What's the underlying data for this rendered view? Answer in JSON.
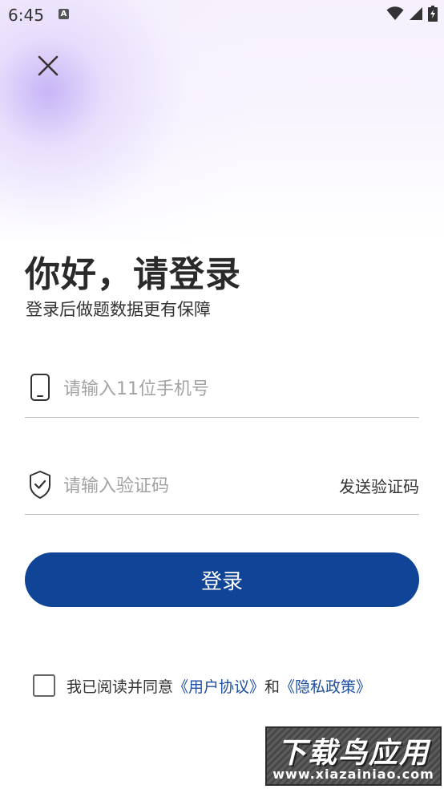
{
  "status_bar": {
    "time": "6:45",
    "notification_icon": "A"
  },
  "header": {
    "close_icon": "close-icon"
  },
  "main": {
    "title": "你好，请登录",
    "subtitle": "登录后做题数据更有保障"
  },
  "form": {
    "phone": {
      "placeholder": "请输入11位手机号",
      "value": "",
      "icon": "phone-icon"
    },
    "code": {
      "placeholder": "请输入验证码",
      "value": "",
      "icon": "shield-check-icon"
    },
    "send_code_label": "发送验证码",
    "login_label": "登录"
  },
  "agreement": {
    "prefix": "我已阅读并同意",
    "user_agreement": "《用户协议》",
    "and": "和",
    "privacy_policy": "《隐私政策》",
    "checked": false
  },
  "watermark": {
    "title": "下载鸟应用",
    "url": "www.xiazainiao.com"
  },
  "colors": {
    "primary": "#0f4497",
    "link": "#1f4fa0",
    "divider": "#bbbbbb"
  }
}
